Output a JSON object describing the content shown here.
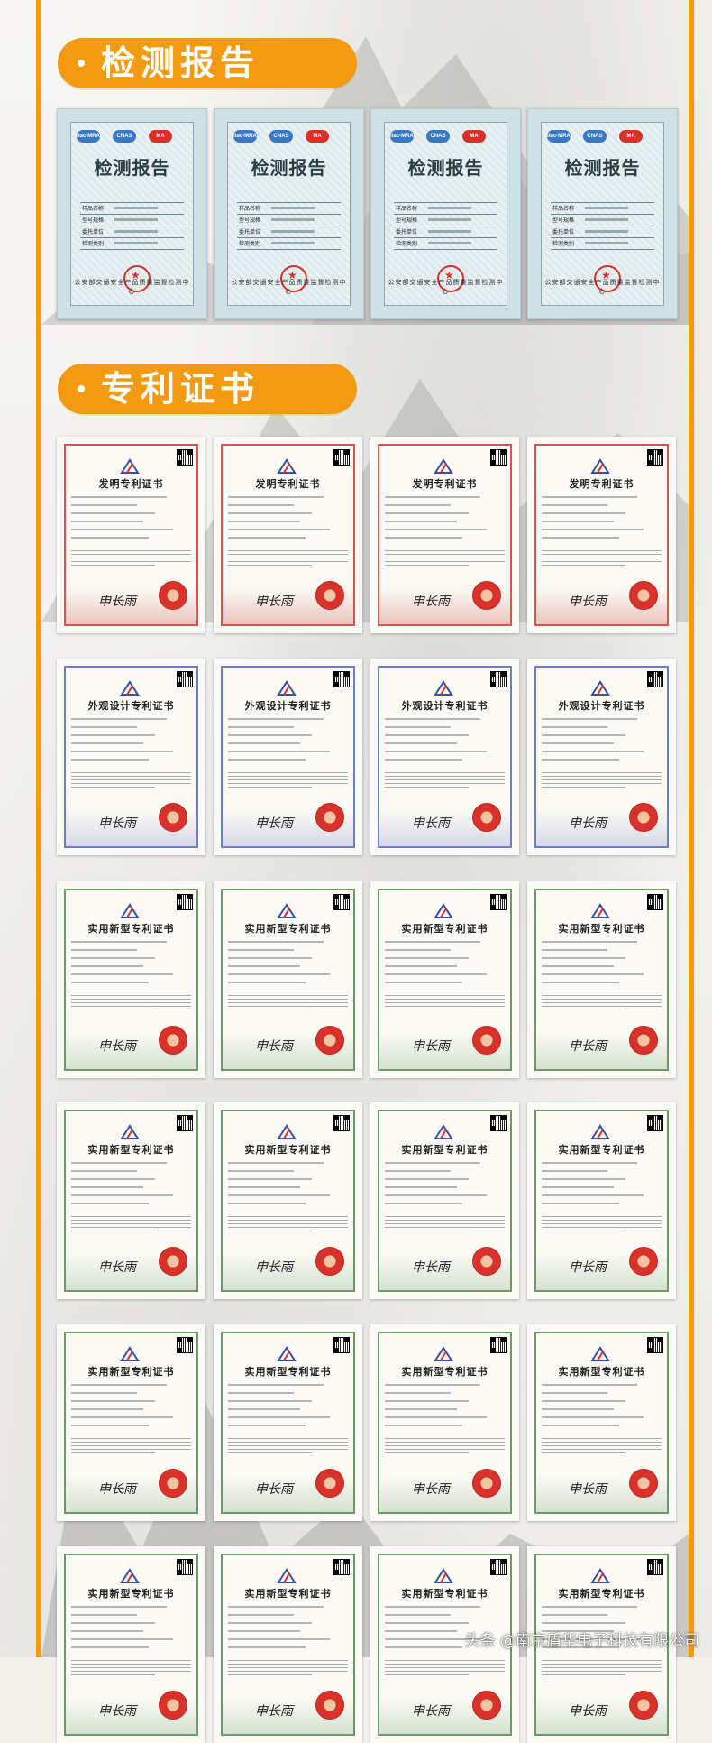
{
  "sections": {
    "reports": {
      "title": "检测报告"
    },
    "patents": {
      "title": "专利证书"
    }
  },
  "report": {
    "title": "检测报告",
    "footer": "公安部交通安全产品质量监督检测中心",
    "logos": [
      "ilac-MRA",
      "CNAS",
      "MA"
    ],
    "field_labels": [
      "样品名称",
      "型号规格",
      "委托单位",
      "检测类别"
    ]
  },
  "patent_titles": {
    "invention": "发明专利证书",
    "design": "外观设计专利证书",
    "utility": "实用新型专利证书"
  },
  "signature": "申长雨",
  "watermark": "头条 @南京盾华电子科技有限公司",
  "colors": {
    "accent": "#f29b12",
    "seal_red": "#d9302a"
  }
}
